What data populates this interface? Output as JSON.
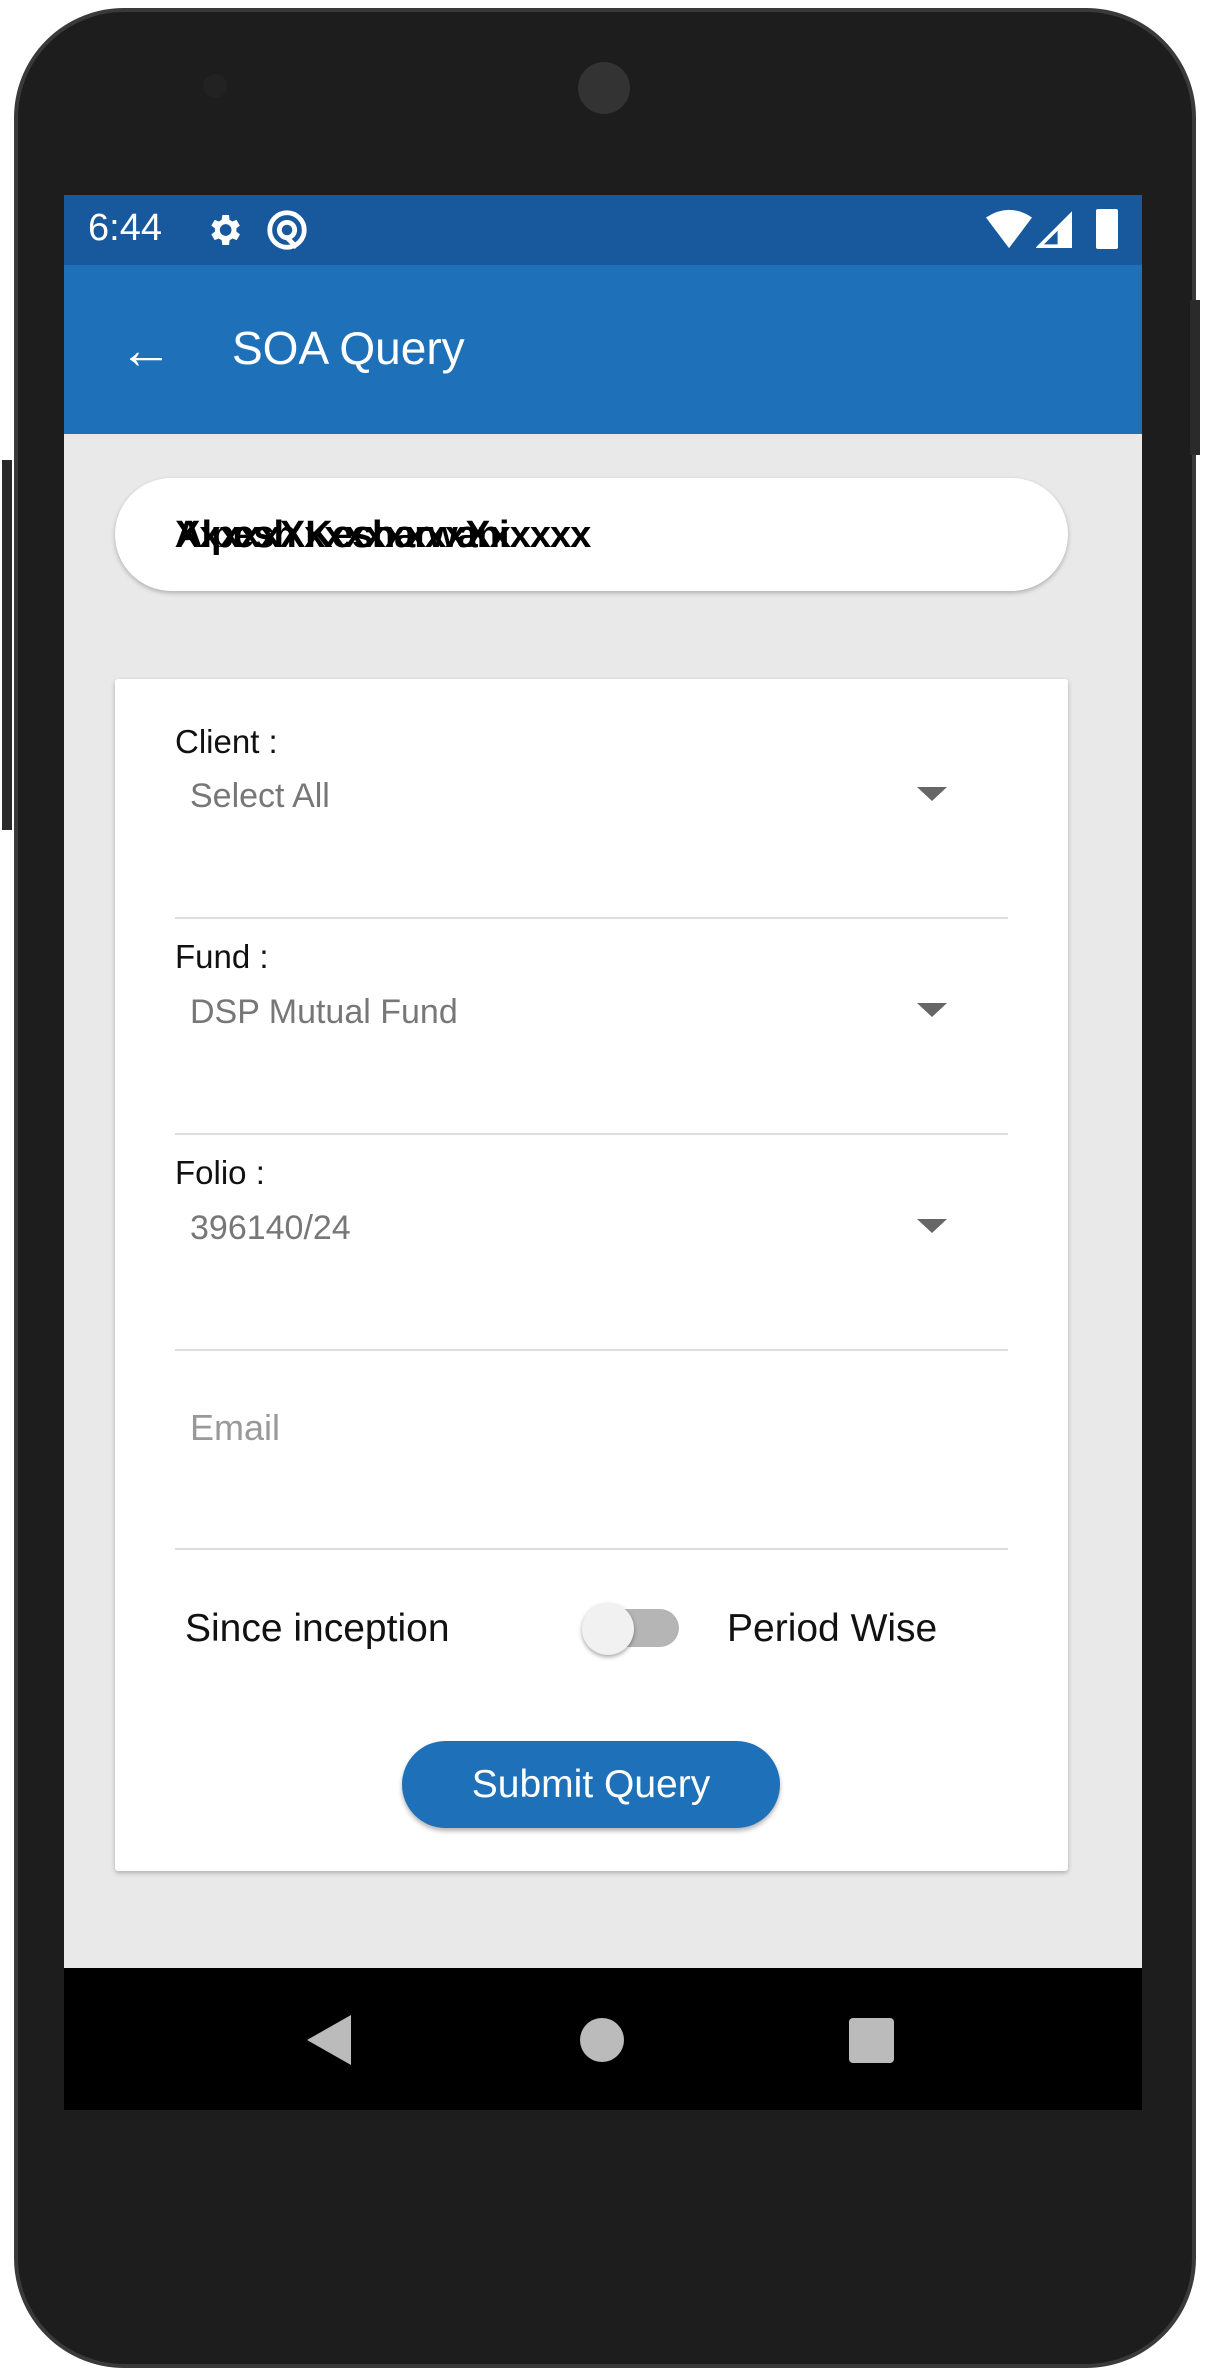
{
  "status_bar": {
    "time": "6:44",
    "icons": [
      "gear-icon",
      "at-sign-icon",
      "wifi-icon",
      "signal-icon",
      "battery-icon"
    ]
  },
  "app_bar": {
    "title": "SOA Query",
    "back_icon": "arrow-left-icon"
  },
  "name_field": {
    "text_layer_1": "Alpesh Kesharwani",
    "text_layer_2": "XxxxxXxxxxxxxxXxxxxx"
  },
  "form": {
    "client": {
      "label": "Client :",
      "value": "Select All"
    },
    "fund": {
      "label": "Fund :",
      "value": "DSP Mutual Fund"
    },
    "folio": {
      "label": "Folio :",
      "value": "396140/24"
    },
    "email": {
      "placeholder": "Email",
      "value": ""
    },
    "toggle": {
      "left_label": "Since inception",
      "right_label": "Period Wise",
      "on": false
    },
    "submit_label": "Submit Query"
  },
  "colors": {
    "primary": "#1e71b9",
    "status_bar": "#17599c",
    "background": "#e9e9e9"
  }
}
